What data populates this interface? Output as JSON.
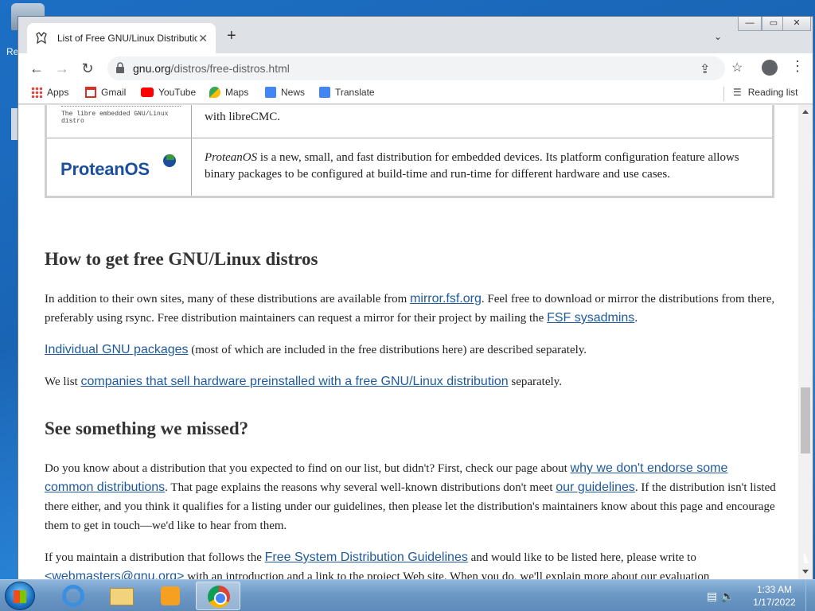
{
  "desktop": {
    "label_fragment": "Re"
  },
  "browser": {
    "tab_title": "List of Free GNU/Linux Distributio",
    "tab_close": "✕",
    "new_tab": "+",
    "tab_search": "⌄",
    "window_controls": {
      "minimize": "—",
      "maximize": "▭",
      "close": "✕"
    },
    "url_host": "gnu.org",
    "url_path": "/distros/free-distros.html",
    "bookmarks": [
      {
        "label": "Apps",
        "icon": "apps-grid-icon",
        "color": "#e84335"
      },
      {
        "label": "Gmail",
        "icon": "gmail-icon",
        "color": "#d93025"
      },
      {
        "label": "YouTube",
        "icon": "youtube-icon",
        "color": "#ff0000"
      },
      {
        "label": "Maps",
        "icon": "maps-icon",
        "color": "#34a853"
      },
      {
        "label": "News",
        "icon": "news-icon",
        "color": "#4285f4"
      },
      {
        "label": "Translate",
        "icon": "translate-icon",
        "color": "#4285f4"
      }
    ],
    "reading_list": "Reading list"
  },
  "page": {
    "table_rows": [
      {
        "logo_caption": "The libre embedded GNU/Linux distro",
        "description": "with libreCMC."
      },
      {
        "logo_text": "ProteanOS",
        "name_italic": "ProteanOS",
        "description": " is a new, small, and fast distribution for embedded devices. Its platform configuration feature allows binary packages to be configured at build-time and run-time for different hardware and use cases."
      }
    ],
    "h_get": "How to get free GNU/Linux distros",
    "p1": {
      "a": "In addition to their own sites, many of these distributions are available from ",
      "link1": "mirror.fsf.org",
      "b": ". Feel free to download or mirror the distributions from there, preferably using rsync. Free distribution maintainers can request a mirror for their project by mailing the ",
      "link2": "FSF sysadmins",
      "c": "."
    },
    "p2": {
      "link": "Individual GNU packages",
      "a": " (most of which are included in the free distributions here) are described separately."
    },
    "p3": {
      "a": "We list ",
      "link": "companies that sell hardware preinstalled with a free GNU/Linux distribution",
      "b": " separately."
    },
    "h_missed": "See something we missed?",
    "p4": {
      "a": "Do you know about a distribution that you expected to find on our list, but didn't? First, check our page about ",
      "link1": "why we don't endorse some common distributions",
      "b": ". That page explains the reasons why several well-known distributions don't meet ",
      "link2": "our guidelines",
      "c": ". If the distribution isn't listed there either, and you think it qualifies for a listing under our guidelines, then please let the distribution's maintainers know about this page and encourage them to get in touch—we'd like to hear from them."
    },
    "p5": {
      "a": "If you maintain a distribution that follows the ",
      "link1": "Free System Distribution Guidelines",
      "b": " and would like to be listed here, please write to ",
      "link2": "<webmasters@gnu.org>",
      "c": " with an introduction and a link to the project Web site. When you do, we'll explain more about our evaluation"
    }
  },
  "taskbar": {
    "time": "1:33 AM",
    "date": "1/17/2022"
  },
  "colors": {
    "link": "#1f5a9e",
    "tab_bg": "#dee1e6"
  }
}
